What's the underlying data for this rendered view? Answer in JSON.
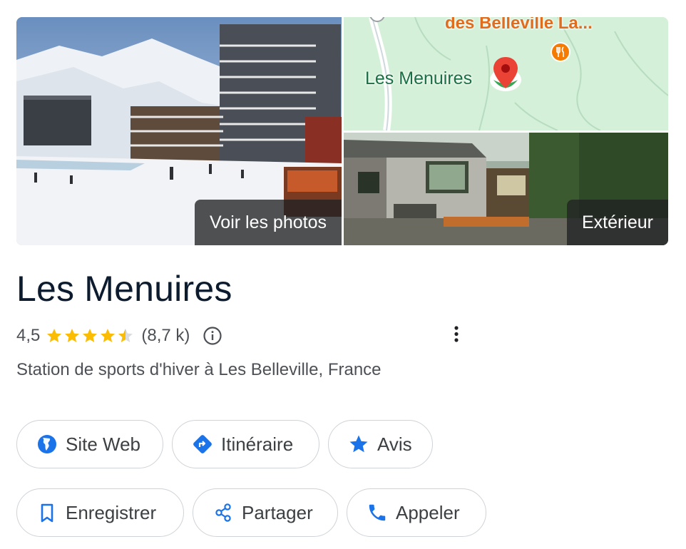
{
  "gallery": {
    "photos_label": "Voir les photos",
    "map_place_top": "des Belleville La...",
    "map_place": "Les Menuires",
    "exterior_label": "Extérieur"
  },
  "place": {
    "title": "Les Menuires",
    "rating": "4,5",
    "rating_value": 4.5,
    "review_count": "(8,7 k)",
    "subtitle": "Station de sports d'hiver à Les Belleville, France"
  },
  "actions": {
    "website": "Site Web",
    "directions": "Itinéraire",
    "reviews": "Avis",
    "save": "Enregistrer",
    "share": "Partager",
    "call": "Appeler"
  },
  "icons": {
    "website": "globe-icon",
    "directions": "directions-icon",
    "reviews": "star-icon",
    "save": "bookmark-icon",
    "share": "share-icon",
    "call": "phone-icon",
    "info": "info-icon",
    "more": "more-vert-icon"
  },
  "colors": {
    "accent": "#1a73e8",
    "star": "#fbbc04",
    "map_pin": "#ea4335",
    "restaurant_pin": "#f57c00"
  }
}
